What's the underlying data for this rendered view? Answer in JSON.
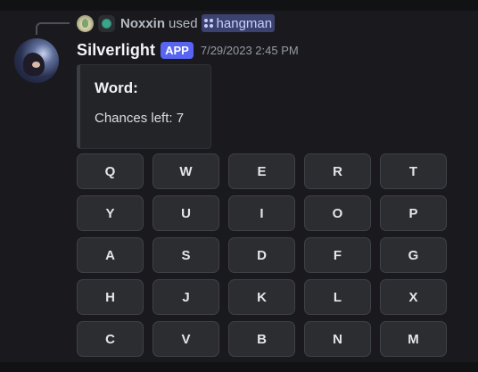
{
  "command_usage": {
    "user_name": "Noxxin",
    "verb": "used",
    "command_name": "hangman",
    "user_avatar_icon": "user-avatar-icon",
    "status_icon": "online-status-icon",
    "command_icon": "slash-command-icon"
  },
  "message": {
    "author": "Silverlight",
    "app_tag": "APP",
    "timestamp": "7/29/2023 2:45 PM",
    "avatar_icon": "bot-avatar-icon"
  },
  "embed": {
    "title": "Word:",
    "description": "Chances left: 7"
  },
  "keyboard": {
    "keys": [
      "Q",
      "W",
      "E",
      "R",
      "T",
      "Y",
      "U",
      "I",
      "O",
      "P",
      "A",
      "S",
      "D",
      "F",
      "G",
      "H",
      "J",
      "K",
      "L",
      "X",
      "C",
      "V",
      "B",
      "N",
      "M"
    ]
  },
  "colors": {
    "background": "#1a1a1e",
    "app_tag": "#5865f2",
    "command_chip": "#3c4270",
    "key_background": "#2b2d31",
    "status_green": "#3ba58b"
  }
}
